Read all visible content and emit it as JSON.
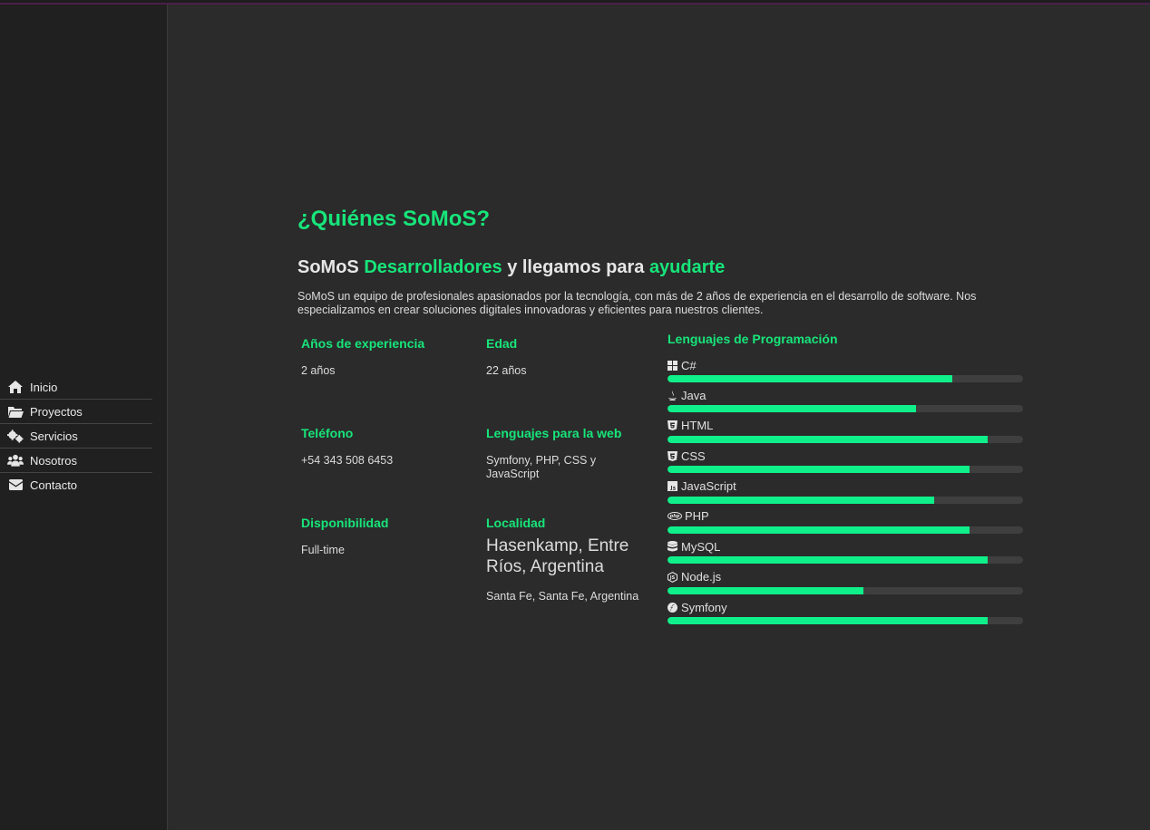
{
  "nav": [
    {
      "label": "Inicio",
      "icon": "home-icon"
    },
    {
      "label": "Proyectos",
      "icon": "folder-open-icon"
    },
    {
      "label": "Servicios",
      "icon": "gears-icon"
    },
    {
      "label": "Nosotros",
      "icon": "users-icon"
    },
    {
      "label": "Contacto",
      "icon": "envelope-icon"
    }
  ],
  "about": {
    "title": "¿Quiénes SoMoS?",
    "subtitle_1": "SoMoS ",
    "subtitle_hl1": "Desarrolladores",
    "subtitle_2": " y llegamos para ",
    "subtitle_hl2": "ayudarte",
    "intro": "SoMoS un equipo de profesionales apasionados por la tecnología, con más de 2 años de experiencia en el desarrollo de software. Nos especializamos en crear soluciones digitales innovadoras y eficientes para nuestros clientes."
  },
  "info": {
    "experience": {
      "label": "Años de experiencia",
      "value": "2 años"
    },
    "age": {
      "label": "Edad",
      "value": "22 años"
    },
    "phone": {
      "label": "Teléfono",
      "value": "+54 343 508 6453"
    },
    "web_languages": {
      "label": "Lenguajes para la web",
      "value": "Symfony, PHP, CSS y JavaScript"
    },
    "availability": {
      "label": "Disponibilidad",
      "value": "Full-time"
    },
    "location": {
      "label": "Localidad",
      "value": "Hasenkamp, Entre Ríos, Argentina",
      "sub": "Santa Fe, Santa Fe, Argentina"
    }
  },
  "skills": {
    "title": "Lenguajes de Programación",
    "items": [
      {
        "name": "C#",
        "icon": "windows-icon",
        "level": 80
      },
      {
        "name": "Java",
        "icon": "java-icon",
        "level": 70
      },
      {
        "name": "HTML",
        "icon": "html5-icon",
        "level": 90
      },
      {
        "name": "CSS",
        "icon": "css3-icon",
        "level": 85
      },
      {
        "name": "JavaScript",
        "icon": "js-icon",
        "level": 75
      },
      {
        "name": "PHP",
        "icon": "php-icon",
        "level": 85
      },
      {
        "name": "MySQL",
        "icon": "database-icon",
        "level": 90
      },
      {
        "name": "Node.js",
        "icon": "nodejs-icon",
        "level": 55
      },
      {
        "name": "Symfony",
        "icon": "symfony-icon",
        "level": 90
      }
    ]
  },
  "colors": {
    "accent": "#17e57a",
    "bar_fill": "#0ff08a",
    "bar_track": "#3f3f3f",
    "background": "#2b2b2b",
    "sidebar": "#202020"
  }
}
